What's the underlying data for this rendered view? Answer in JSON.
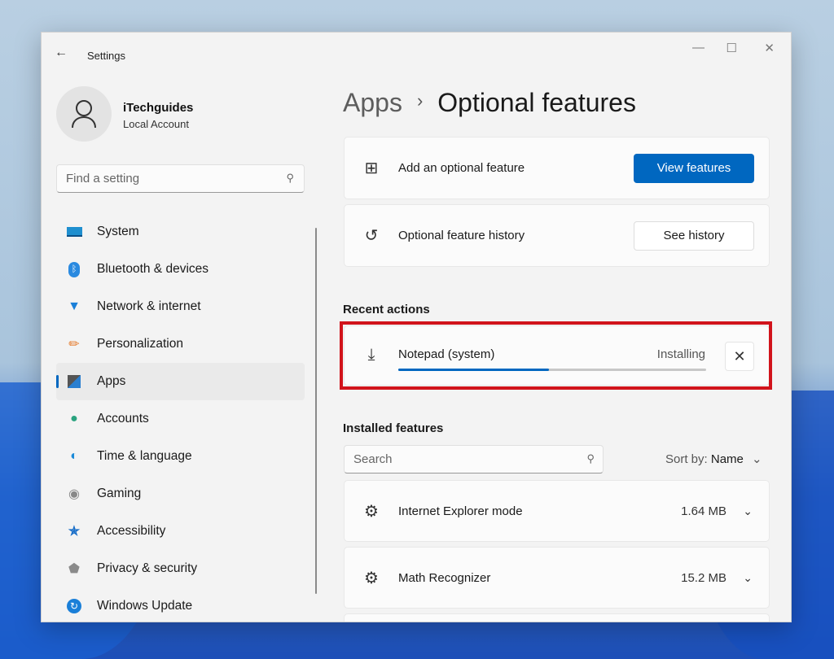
{
  "window": {
    "title": "Settings"
  },
  "user": {
    "name": "iTechguides",
    "type": "Local Account"
  },
  "search": {
    "placeholder": "Find a setting"
  },
  "nav": [
    {
      "label": "System",
      "icon": "system-icon"
    },
    {
      "label": "Bluetooth & devices",
      "icon": "bluetooth-icon"
    },
    {
      "label": "Network & internet",
      "icon": "wifi-icon"
    },
    {
      "label": "Personalization",
      "icon": "brush-icon"
    },
    {
      "label": "Apps",
      "icon": "apps-icon",
      "selected": true
    },
    {
      "label": "Accounts",
      "icon": "person-icon"
    },
    {
      "label": "Time & language",
      "icon": "globe-clock-icon"
    },
    {
      "label": "Gaming",
      "icon": "gamepad-icon"
    },
    {
      "label": "Accessibility",
      "icon": "accessibility-icon"
    },
    {
      "label": "Privacy & security",
      "icon": "shield-icon"
    },
    {
      "label": "Windows Update",
      "icon": "update-icon"
    }
  ],
  "breadcrumb": {
    "parent": "Apps",
    "current": "Optional features"
  },
  "add": {
    "label": "Add an optional feature",
    "button": "View features"
  },
  "history": {
    "label": "Optional feature history",
    "button": "See history"
  },
  "recent": {
    "heading": "Recent actions",
    "item": "Notepad (system)",
    "status": "Installing",
    "progress_percent": 49
  },
  "installed": {
    "heading": "Installed features",
    "search_placeholder": "Search",
    "sort_label": "Sort by:",
    "sort_value": "Name",
    "items": [
      {
        "name": "Internet Explorer mode",
        "size": "1.64 MB"
      },
      {
        "name": "Math Recognizer",
        "size": "15.2 MB"
      }
    ]
  },
  "colors": {
    "accent": "#0067c0",
    "highlight": "#d1131b"
  }
}
